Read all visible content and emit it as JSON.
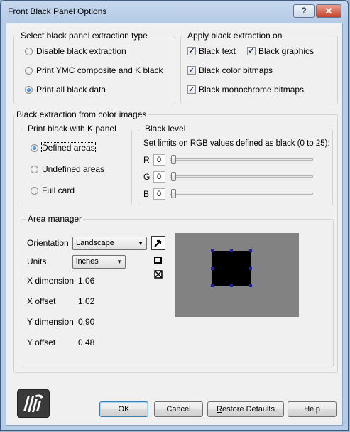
{
  "window": {
    "title": "Front Black Panel Options",
    "help_glyph": "?",
    "close_glyph": "✕"
  },
  "extraction_type": {
    "legend": "Select black panel extraction type",
    "options": [
      {
        "label": "Disable black extraction",
        "checked": false
      },
      {
        "label": "Print YMC composite and K black",
        "checked": false
      },
      {
        "label": "Print all black data",
        "checked": true
      }
    ]
  },
  "apply_on": {
    "legend": "Apply black extraction on",
    "options": [
      {
        "label": "Black text",
        "checked": true
      },
      {
        "label": "Black graphics",
        "checked": true
      },
      {
        "label": "Black color bitmaps",
        "checked": true
      },
      {
        "label": "Black monochrome bitmaps",
        "checked": true
      }
    ]
  },
  "color_images": {
    "legend": "Black extraction from color images",
    "print_k": {
      "legend": "Print black with K panel",
      "options": [
        {
          "label": "Defined areas",
          "checked": true
        },
        {
          "label": "Undefined areas",
          "checked": false
        },
        {
          "label": "Full card",
          "checked": false
        }
      ]
    },
    "black_level": {
      "legend": "Black level",
      "instruction": "Set limits on RGB values defined as black (0 to 25):",
      "channels": [
        {
          "label": "R",
          "value": "0"
        },
        {
          "label": "G",
          "value": "0"
        },
        {
          "label": "B",
          "value": "0"
        }
      ]
    }
  },
  "area_manager": {
    "legend": "Area manager",
    "orientation_label": "Orientation",
    "orientation_value": "Landscape",
    "units_label": "Units",
    "units_value": "inches",
    "fields": [
      {
        "label": "X dimension",
        "value": "1.06"
      },
      {
        "label": "X offset",
        "value": "1.02"
      },
      {
        "label": "Y dimension",
        "value": "0.90"
      },
      {
        "label": "Y offset",
        "value": "0.48"
      }
    ],
    "tools": [
      "arrow-icon",
      "rectangle-icon",
      "delete-area-icon"
    ],
    "preview_color": "#828282",
    "area_color": "#000000",
    "handle_color": "#1d1da5"
  },
  "buttons": {
    "ok": "OK",
    "cancel": "Cancel",
    "restore_prefix": "R",
    "restore_rest": "estore Defaults",
    "help": "Help"
  },
  "logo": "zebra-logo"
}
